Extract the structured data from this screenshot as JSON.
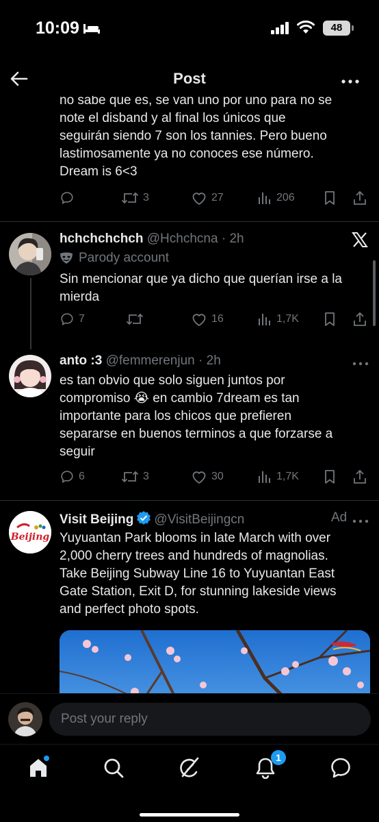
{
  "status_bar": {
    "time": "10:09",
    "battery": "48"
  },
  "header": {
    "title": "Post"
  },
  "tweets": [
    {
      "text_lines": [
        "no sabe que es, se van uno por uno para no se",
        "note el disband y al final los únicos que",
        "seguirán siendo 7 son los tannies. Pero bueno",
        "lastimosamente ya no conoces ese número.",
        "Dream is 6<3"
      ],
      "replies": "",
      "reposts": "3",
      "likes": "27",
      "views": "206"
    },
    {
      "name": "hchchchchch",
      "handle": "@Hchchcna",
      "time": "2h",
      "parody_label": "Parody account",
      "text_lines": [
        "Sin mencionar que ya dicho que querían irse a la",
        "mierda"
      ],
      "replies": "7",
      "reposts": "",
      "likes": "16",
      "views": "1,7K"
    },
    {
      "name": "anto :3",
      "handle": "@femmerenjun",
      "time": "2h",
      "text_lines": [
        "es tan obvio que solo siguen juntos por",
        "compromiso 😭 en cambio 7dream es tan",
        "importante para los chicos que prefieren",
        "separarse en buenos terminos a que forzarse a",
        "seguir"
      ],
      "replies": "6",
      "reposts": "3",
      "likes": "30",
      "views": "1,7K"
    },
    {
      "name": "Visit Beijing",
      "handle": "@VisitBeijingcn",
      "ad_label": "Ad",
      "logo_text": "Beijing",
      "text_lines": [
        "Yuyuantan Park blooms in late March with over",
        "2,000 cherry trees and hundreds of magnolias.",
        "Take Beijing Subway Line 16 to Yuyuantan East",
        "Gate Station, Exit D, for stunning lakeside views",
        "and perfect photo spots."
      ]
    }
  ],
  "reply": {
    "placeholder": "Post your reply"
  },
  "tab_bar": {
    "notifications_badge": "1"
  },
  "colors": {
    "background": "#000000",
    "text": "#e7e9ea",
    "muted": "#71767b",
    "accent": "#1d9bf0",
    "divider": "#2f3336"
  },
  "icons": [
    "back-arrow-icon",
    "more-icon",
    "reply-icon",
    "repost-icon",
    "like-icon",
    "views-icon",
    "bookmark-icon",
    "share-icon",
    "x-logo-icon",
    "verified-icon",
    "home-icon",
    "search-icon",
    "grok-icon",
    "bell-icon",
    "messages-icon"
  ]
}
